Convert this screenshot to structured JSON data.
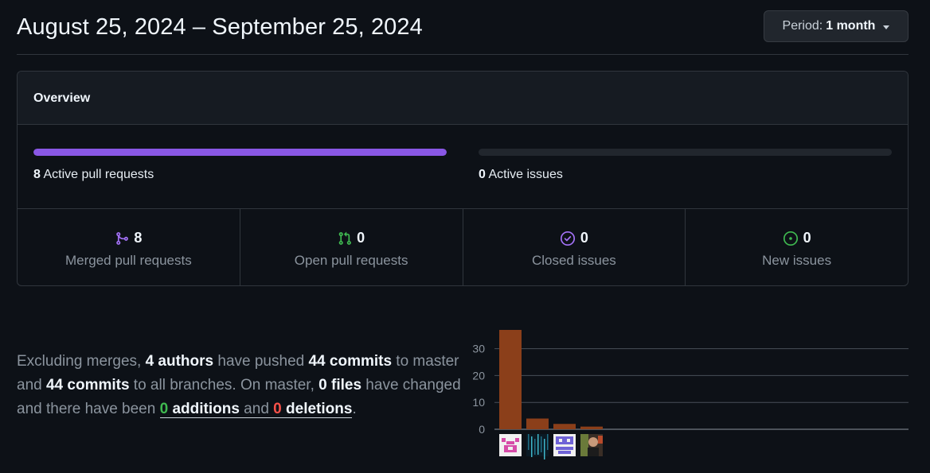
{
  "header": {
    "date_range": "August 25, 2024 – September 25, 2024",
    "period_label": "Period:",
    "period_value": "1 month"
  },
  "overview": {
    "title": "Overview",
    "active_prs_count": "8",
    "active_prs_label": " Active pull requests",
    "active_prs_fill_fraction": 1.0,
    "active_issues_count": "0",
    "active_issues_label": " Active issues",
    "active_issues_fill_fraction": 0.0,
    "stats": [
      {
        "icon": "git-merge-icon",
        "color": "#a371f7",
        "value": "8",
        "label": "Merged pull requests"
      },
      {
        "icon": "git-pull-request-icon",
        "color": "#3fb950",
        "value": "0",
        "label": "Open pull requests"
      },
      {
        "icon": "issue-closed-icon",
        "color": "#a371f7",
        "value": "0",
        "label": "Closed issues"
      },
      {
        "icon": "issue-opened-icon",
        "color": "#3fb950",
        "value": "0",
        "label": "New issues"
      }
    ]
  },
  "summary": {
    "t1": "Excluding merges, ",
    "authors": "4 authors",
    "t2": " have pushed ",
    "commits_master": "44 commits",
    "t3": " to master and ",
    "commits_all": "44 commits",
    "t4": " to all branches. On master, ",
    "files": "0 files",
    "t5": " have changed and there have been ",
    "additions_num": "0",
    "additions_word": " additions",
    "and": " and ",
    "deletions_num": "0",
    "deletions_word": " deletions",
    "t6": "."
  },
  "chart_data": {
    "type": "bar",
    "categories": [
      "author-1",
      "author-2",
      "author-3",
      "author-4"
    ],
    "values": [
      37,
      4,
      2,
      1
    ],
    "y_ticks": [
      "0",
      "10",
      "20",
      "30"
    ],
    "ylim": [
      0,
      37
    ],
    "grid": true,
    "bar_color": "#8b3f1a",
    "avatar_icons": [
      "identicon-pink-avatar",
      "matrix-avatar",
      "identicon-purple-avatar",
      "photo-avatar"
    ]
  }
}
